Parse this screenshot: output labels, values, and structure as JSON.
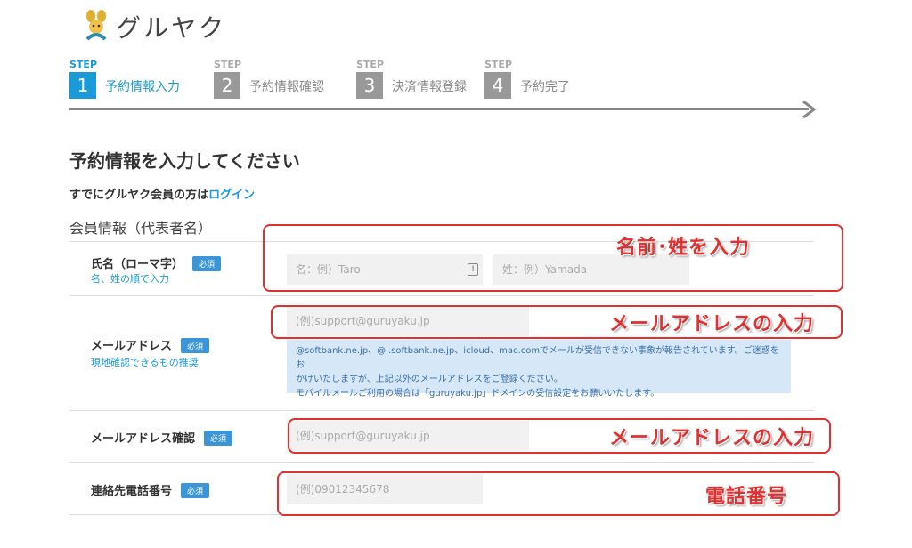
{
  "logo": {
    "text": "グルヤク"
  },
  "steps": [
    {
      "caption": "STEP",
      "number": "1",
      "label": "予約情報入力",
      "active": true
    },
    {
      "caption": "STEP",
      "number": "2",
      "label": "予約情報確認",
      "active": false
    },
    {
      "caption": "STEP",
      "number": "3",
      "label": "決済情報登録",
      "active": false
    },
    {
      "caption": "STEP",
      "number": "4",
      "label": "予約完了",
      "active": false
    }
  ],
  "page_title": "予約情報を入力してください",
  "login": {
    "prefix": "すでにグルヤク会員の方は",
    "link": "ログイン"
  },
  "section_title": "会員情報（代表者名）",
  "required_badge": "必須",
  "rows": {
    "name": {
      "label": "氏名（ローマ字）",
      "sub": "名、姓の順で入力",
      "first_placeholder": "名：例）Taro",
      "last_placeholder": "姓：例）Yamada"
    },
    "email": {
      "label": "メールアドレス",
      "sub": "現地確認できるもの推奨",
      "placeholder": "(例)support@guruyaku.jp",
      "note_1": "@softbank.ne.jp、@i.softbank.ne.jp、icloud、mac.comでメールが受信できない事象が報告されています。ご迷惑をお",
      "note_2": "かけいたしますが、上記以外のメールアドレスをご登録ください。",
      "note_3": "モバイルメールご利用の場合は「guruyaku.jp」ドメインの受信設定をお願いいたします。"
    },
    "email_confirm": {
      "label": "メールアドレス確認",
      "placeholder": "(例)support@guruyaku.jp"
    },
    "phone": {
      "label": "連絡先電話番号",
      "placeholder": "(例)09012345678"
    }
  },
  "annotations": {
    "name": "名前･姓を入力",
    "email": "メールアドレスの入力",
    "email_confirm": "メールアドレスの入力",
    "phone": "電話番号"
  },
  "colors": {
    "accent": "#1a9ad6",
    "annotation": "#e03030",
    "step_inactive": "#999999"
  }
}
